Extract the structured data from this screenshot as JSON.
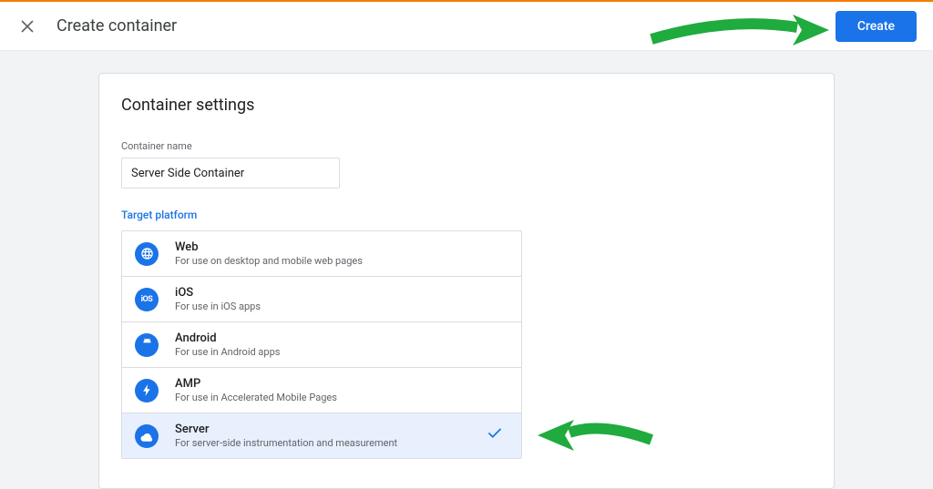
{
  "header": {
    "title": "Create container",
    "create_button": "Create"
  },
  "card": {
    "title": "Container settings",
    "container_name_label": "Container name",
    "container_name_value": "Server Side Container",
    "target_platform_label": "Target platform"
  },
  "platforms": [
    {
      "name": "Web",
      "desc": "For use on desktop and mobile web pages",
      "icon": "globe-icon",
      "selected": false
    },
    {
      "name": "iOS",
      "desc": "For use in iOS apps",
      "icon": "ios-icon",
      "selected": false
    },
    {
      "name": "Android",
      "desc": "For use in Android apps",
      "icon": "android-icon",
      "selected": false
    },
    {
      "name": "AMP",
      "desc": "For use in Accelerated Mobile Pages",
      "icon": "amp-icon",
      "selected": false
    },
    {
      "name": "Server",
      "desc": "For server-side instrumentation and measurement",
      "icon": "server-icon",
      "selected": true
    }
  ]
}
